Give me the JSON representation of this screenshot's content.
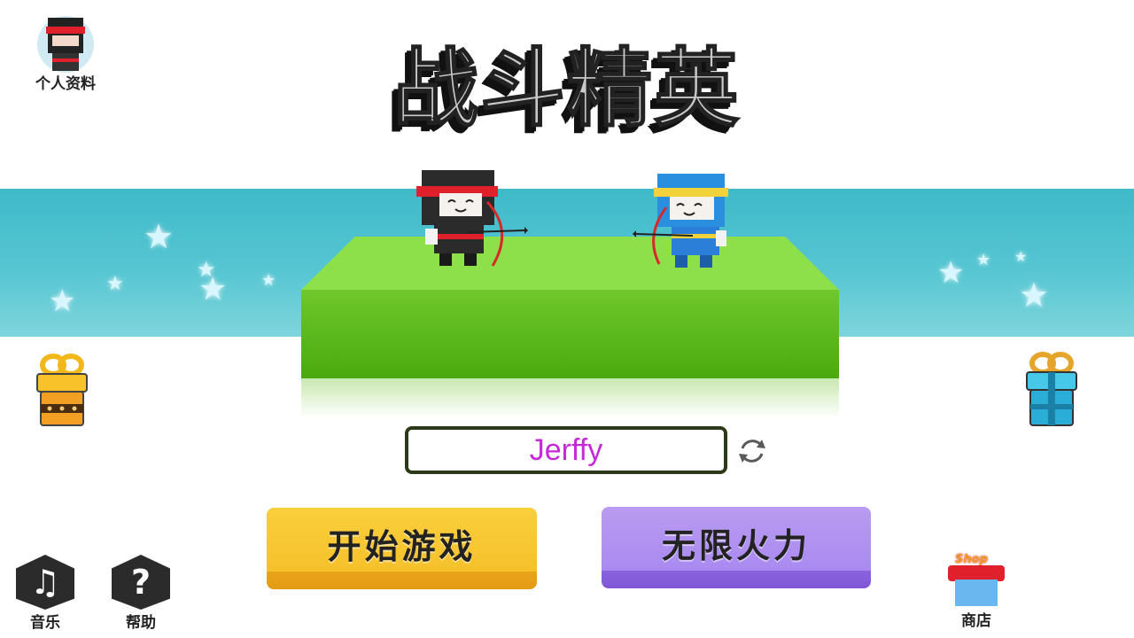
{
  "title": "战斗精英",
  "profile": {
    "label": "个人资料",
    "icon": "ninja-avatar-icon"
  },
  "player_name": "Jerffy",
  "buttons": {
    "start": "开始游戏",
    "unlimited": "无限火力"
  },
  "bottom_left": {
    "music_label": "音乐",
    "music_icon": "♫",
    "help_label": "帮助",
    "help_icon": "?"
  },
  "shop": {
    "label": "商店",
    "badge": "Shop"
  },
  "colors": {
    "sky_band": "#4fc1ce",
    "platform": "#7ed33b",
    "name_text": "#c42ad6",
    "start_button": "#f6c12b",
    "unlimited_button": "#a98af0"
  }
}
